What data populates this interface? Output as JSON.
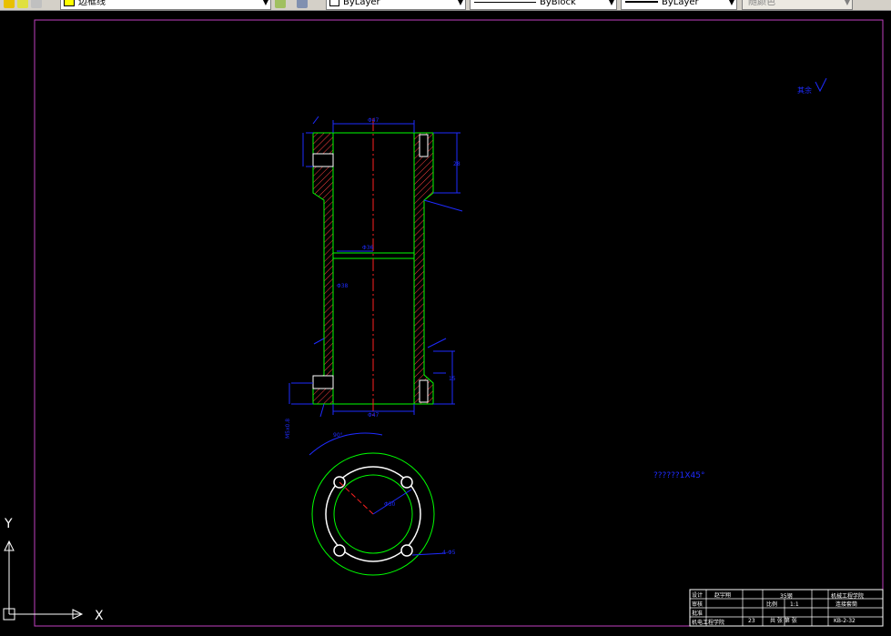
{
  "toolbar": {
    "layer_name": "边框线",
    "color_value": "ByLayer",
    "linetype_value": "ByBlock",
    "lineweight_value": "ByLayer",
    "plotstyle_value": "随颜色"
  },
  "drawing": {
    "roughness_note": "其余",
    "chamfer_note": "??????1X45°",
    "dims": {
      "top_width": "Φ47",
      "bottom_width": "Φ47",
      "bore": "Φ36",
      "left_mid": "Φ38",
      "flange_height": "28",
      "lower_flange": "15",
      "arc": "90°",
      "pcd": "Φ50",
      "hole": "4-Φ5",
      "thread_note": "M5x0.8"
    }
  },
  "ucs": {
    "x_label": "X",
    "y_label": "Y"
  },
  "title_block": {
    "design_label": "设计",
    "design_name": "赵宇翔",
    "check_label": "审核",
    "approve_label": "批准",
    "material": "35钢",
    "school": "机械工程学院",
    "scale_label": "比例",
    "scale_value": "1:1",
    "part_name": "连接套筒",
    "course_label": "机电工程学院",
    "count": "23",
    "sheet_label": "共 张 第 张",
    "drawing_no": "KB-2-32"
  },
  "colors": {
    "border": "#c040c0",
    "outline": "#00ff00",
    "center": "#ff2020",
    "hatch": "#ff4040",
    "dimension": "#1e2bff",
    "white": "#ffffff"
  }
}
